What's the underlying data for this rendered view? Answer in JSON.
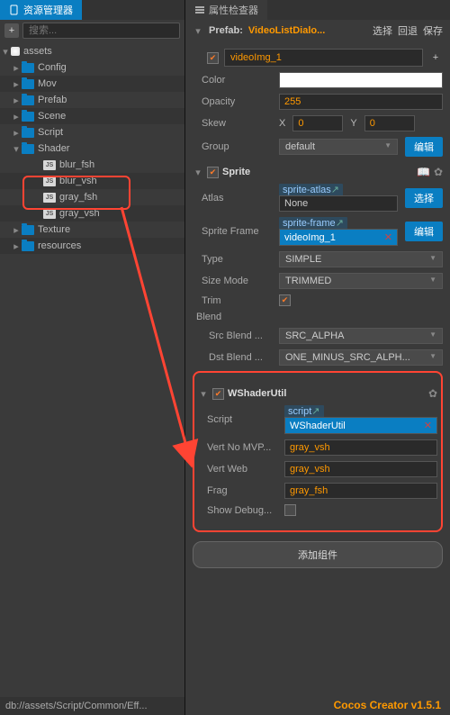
{
  "left": {
    "tabTitle": "资源管理器",
    "searchPlaceholder": "搜索...",
    "root": "assets",
    "folders": [
      "Config",
      "Mov",
      "Prefab",
      "Scene",
      "Script"
    ],
    "shaderFolder": "Shader",
    "shaderFiles": [
      "blur_fsh",
      "blur_vsh",
      "gray_fsh",
      "gray_vsh"
    ],
    "postFolders": [
      "Texture",
      "resources"
    ],
    "status": "db://assets/Script/Common/Eff..."
  },
  "right": {
    "tabTitle": "属性检查器",
    "prefabLabel": "Prefab:",
    "prefabName": "VideoListDialo...",
    "btnSelect": "选择",
    "btnBack": "回退",
    "btnSave": "保存",
    "nodeName": "videoImg_1",
    "color": "Color",
    "opacity": "Opacity",
    "opacityVal": "255",
    "skew": "Skew",
    "skewXLbl": "X",
    "skewX": "0",
    "skewYLbl": "Y",
    "skewY": "0",
    "group": "Group",
    "groupVal": "default",
    "groupEdit": "编辑",
    "sprite": {
      "title": "Sprite",
      "atlas": "Atlas",
      "atlasTag": "sprite-atlas",
      "atlasVal": "None",
      "atlasBtn": "选择",
      "frame": "Sprite Frame",
      "frameTag": "sprite-frame",
      "frameVal": "videoImg_1",
      "frameBtn": "编辑",
      "type": "Type",
      "typeVal": "SIMPLE",
      "sizeMode": "Size Mode",
      "sizeModeVal": "TRIMMED",
      "trim": "Trim",
      "blend": "Blend",
      "srcBlend": "Src Blend ...",
      "srcBlendVal": "SRC_ALPHA",
      "dstBlend": "Dst Blend ...",
      "dstBlendVal": "ONE_MINUS_SRC_ALPH..."
    },
    "wsu": {
      "title": "WShaderUtil",
      "scriptLbl": "Script",
      "scriptTag": "script",
      "scriptVal": "WShaderUtil",
      "vertNo": "Vert No MVP...",
      "vertNoVal": "gray_vsh",
      "vertWeb": "Vert Web",
      "vertWebVal": "gray_vsh",
      "frag": "Frag",
      "fragVal": "gray_fsh",
      "showDebug": "Show Debug..."
    },
    "addComp": "添加组件"
  },
  "footer": "Cocos Creator v1.5.1"
}
